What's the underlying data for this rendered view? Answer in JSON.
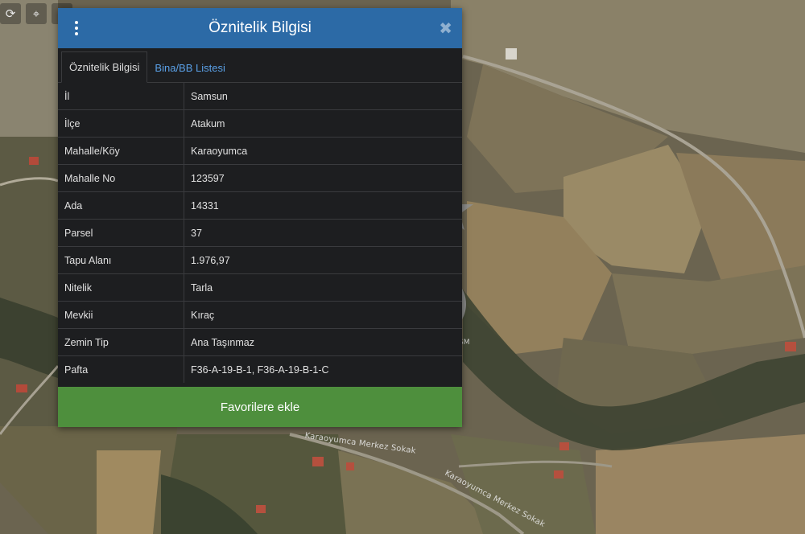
{
  "toolbar": {
    "icons": [
      "refresh-icon",
      "crosshair-icon",
      "info-icon"
    ],
    "glyphs": [
      "⟳",
      "⌖",
      "i"
    ]
  },
  "panel": {
    "title": "Öznitelik Bilgisi",
    "close_glyph": "✖",
    "tabs": [
      {
        "label": "Öznitelik Bilgisi",
        "active": true
      },
      {
        "label": "Bina/BB Listesi",
        "active": false
      }
    ],
    "rows": [
      {
        "key": "İl",
        "value": "Samsun"
      },
      {
        "key": "İlçe",
        "value": "Atakum"
      },
      {
        "key": "Mahalle/Köy",
        "value": "Karaoyumca"
      },
      {
        "key": "Mahalle No",
        "value": "123597"
      },
      {
        "key": "Ada",
        "value": "14331"
      },
      {
        "key": "Parsel",
        "value": "37"
      },
      {
        "key": "Tapu Alanı",
        "value": "1.976,97"
      },
      {
        "key": "Nitelik",
        "value": "Tarla"
      },
      {
        "key": "Mevkii",
        "value": "Kıraç"
      },
      {
        "key": "Zemin Tip",
        "value": "Ana Taşınmaz"
      },
      {
        "key": "Pafta",
        "value": "F36-A-19-B-1, F36-A-19-B-1-C"
      }
    ],
    "favorite_button": "Favorilere ekle"
  },
  "map": {
    "road_labels": [
      "Karaoyumca Merkez Sokak",
      "Karaoyumca Merkez Sokak"
    ],
    "watermark_mark": "SM"
  },
  "colors": {
    "header": "#2c6aa6",
    "panel_bg": "#1d1e20",
    "button": "#4e8f3d",
    "link": "#5aa0e6"
  }
}
